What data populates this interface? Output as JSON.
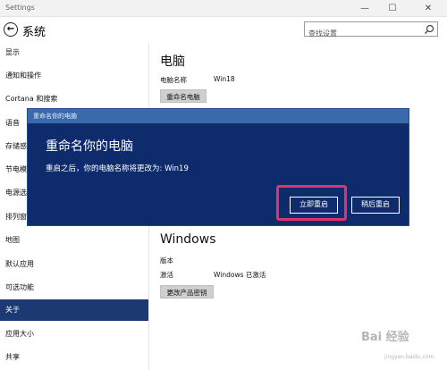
{
  "window": {
    "title": "Settings",
    "controls": {
      "minimize": "—",
      "maximize": "☐",
      "close": "✕"
    }
  },
  "header": {
    "back_icon": "back-arrow-icon",
    "title": "系统",
    "search_placeholder": "查找设置",
    "search_icon": "search-icon"
  },
  "sidebar": {
    "items": [
      {
        "label": "显示"
      },
      {
        "label": "通知和操作"
      },
      {
        "label": "Cortana 和搜索"
      },
      {
        "label": "语音"
      },
      {
        "label": "存储感知"
      },
      {
        "label": "节电模式"
      },
      {
        "label": "电源选项"
      },
      {
        "label": "排列窗口"
      },
      {
        "label": "地图"
      },
      {
        "label": "默认应用"
      },
      {
        "label": "可选功能"
      },
      {
        "label": "关于",
        "active": true
      },
      {
        "label": "应用大小"
      },
      {
        "label": "共享"
      }
    ]
  },
  "main": {
    "pc_section": {
      "title": "电脑",
      "name_label": "电脑名称",
      "name_value": "Win18",
      "rename_button": "重命名电脑"
    },
    "windows_section": {
      "title": "Windows",
      "edition_label": "版本",
      "activation_label": "激活",
      "activation_value": "Windows 已激活",
      "change_key_button": "更改产品密钥"
    }
  },
  "dialog": {
    "title": "重命名你的电脑",
    "heading": "重命名你的电脑",
    "message": "重启之后，你的电脑名称将更改为: Win19",
    "restart_now": "立即重启",
    "restart_later": "稍后重启",
    "highlight_color": "#e0326d",
    "background_color": "#0e2c6c"
  },
  "watermark": {
    "text": "Bai 经验",
    "sub": "jingyan.baidu.com"
  }
}
